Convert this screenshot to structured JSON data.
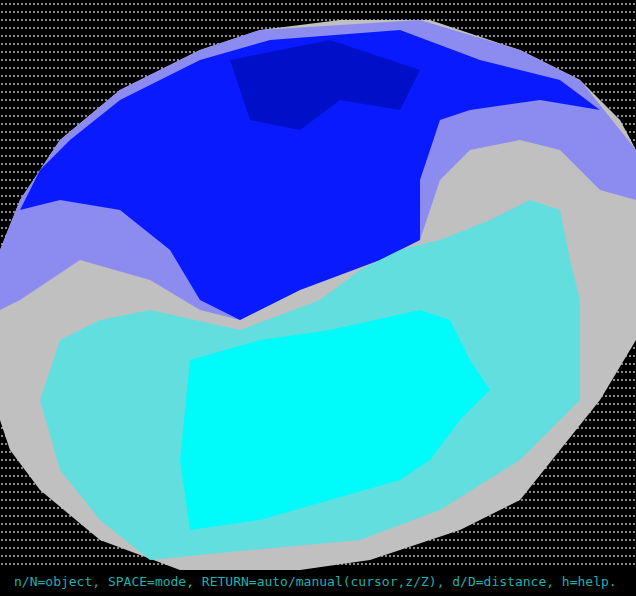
{
  "viewport": {
    "regions": [
      {
        "name": "rim",
        "color": "#c0c0c0"
      },
      {
        "name": "upper-band",
        "color": "#8c8cf0"
      },
      {
        "name": "upper-face",
        "color": "#0a1aff"
      },
      {
        "name": "shadow",
        "color": "#0010c8"
      },
      {
        "name": "lower-face",
        "color": "#62dede"
      },
      {
        "name": "highlight",
        "color": "#00fbfb"
      }
    ]
  },
  "status_bar": {
    "text": "n/N=object, SPACE=mode, RETURN=auto/manual(cursor,z/Z), d/D=distance, h=help."
  }
}
